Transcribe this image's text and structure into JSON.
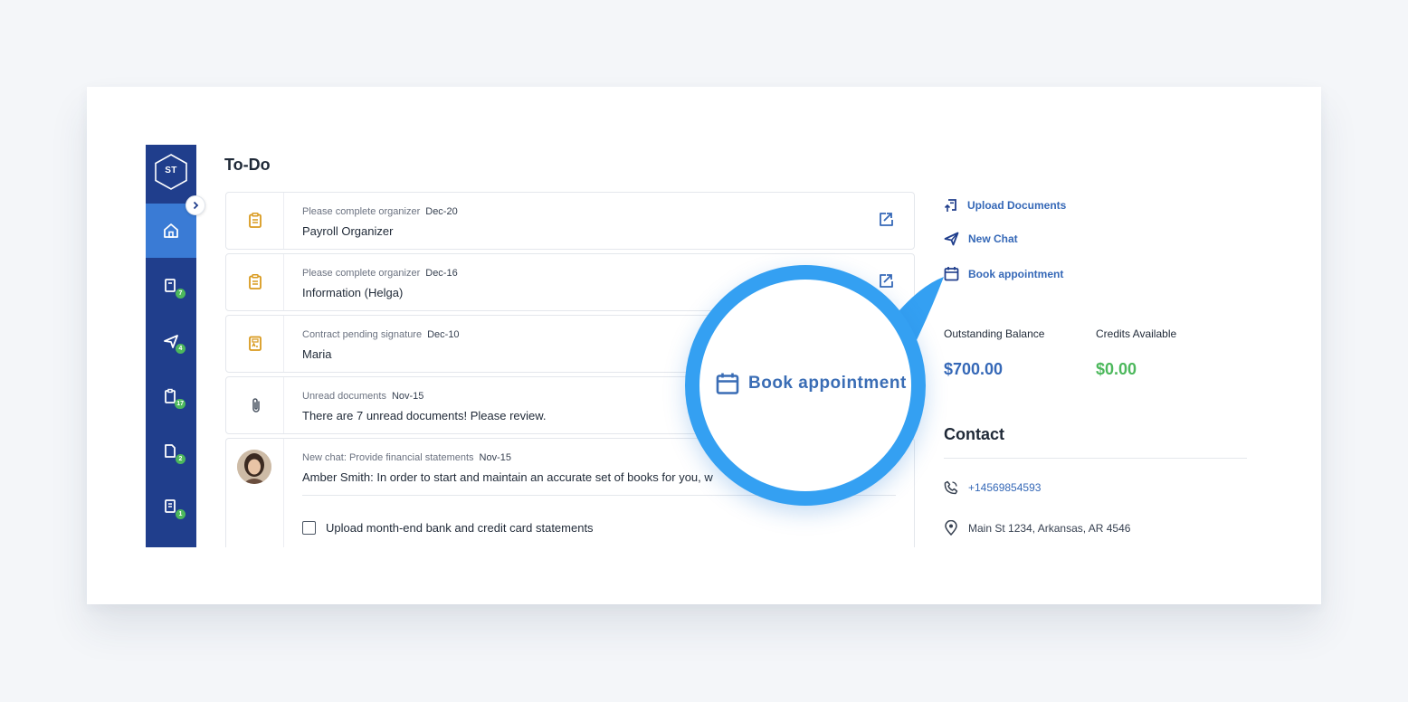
{
  "sidebar": {
    "logo_text": "ST",
    "items": [
      {
        "name": "home",
        "icon": "home-icon",
        "badge": ""
      },
      {
        "name": "organizers",
        "icon": "document-edit-icon",
        "badge": "7"
      },
      {
        "name": "chats",
        "icon": "paper-plane-icon",
        "badge": "4"
      },
      {
        "name": "documents",
        "icon": "clipboard-icon",
        "badge": "17"
      },
      {
        "name": "files",
        "icon": "file-icon",
        "badge": "2"
      },
      {
        "name": "tasks",
        "icon": "list-icon",
        "badge": "1"
      }
    ]
  },
  "todo": {
    "title": "To-Do",
    "items": [
      {
        "icon": "clipboard-icon",
        "meta": "Please complete organizer",
        "date": "Dec-20",
        "text": "Payroll Organizer"
      },
      {
        "icon": "clipboard-icon",
        "meta": "Please complete organizer",
        "date": "Dec-16",
        "text": "Information (Helga)"
      },
      {
        "icon": "signature-file-icon",
        "meta": "Contract pending signature",
        "date": "Dec-10",
        "text": "Maria"
      },
      {
        "icon": "paperclip-icon",
        "meta": "Unread documents",
        "date": "Nov-15",
        "text": "There are 7 unread documents! Please review."
      }
    ],
    "chat": {
      "meta": "New chat: Provide financial statements",
      "date": "Nov-15",
      "text": "Amber Smith: In order to start and maintain an accurate set of books for you, w",
      "task": "Upload month-end bank and credit card statements"
    }
  },
  "quick_actions": [
    {
      "icon": "upload-document-icon",
      "label": "Upload Documents"
    },
    {
      "icon": "paper-plane-icon",
      "label": "New Chat"
    },
    {
      "icon": "calendar-icon",
      "label": "Book appointment"
    }
  ],
  "balances": {
    "outstanding_label": "Outstanding Balance",
    "outstanding_value": "$700.00",
    "credits_label": "Credits Available",
    "credits_value": "$0.00"
  },
  "contact": {
    "title": "Contact",
    "phone": "+14569854593",
    "address": "Main St 1234, Arkansas, AR 4546"
  },
  "magnifier": {
    "label": "Book appointment",
    "icon": "calendar-icon"
  },
  "colors": {
    "sidebar": "#203e8c",
    "sidebar_active": "#3a7bd5",
    "link_blue": "#3568b7",
    "balance_blue": "#3568b7",
    "credit_green": "#4cb85c",
    "magnifier_ring": "#34a0f2",
    "todo_icon_orange": "#d99a1e",
    "badge_green": "#4cb85c"
  }
}
